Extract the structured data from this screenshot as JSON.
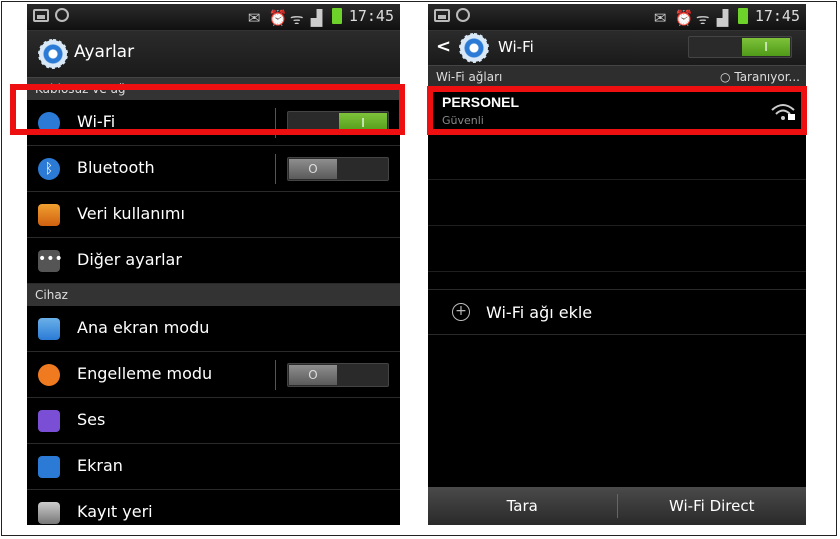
{
  "status": {
    "time": "17:45"
  },
  "left": {
    "title": "Ayarlar",
    "sections": {
      "wireless": "Kablosuz ve ağ",
      "device": "Cihaz"
    },
    "items": [
      {
        "label": "Wi-Fi",
        "icon": "wifi-icon",
        "toggle": "on",
        "toggle_text": "I"
      },
      {
        "label": "Bluetooth",
        "icon": "bluetooth-icon",
        "toggle": "off",
        "toggle_text": "O"
      },
      {
        "label": "Veri kullanımı",
        "icon": "data-usage-icon"
      },
      {
        "label": "Diğer ayarlar",
        "icon": "more-icon"
      },
      {
        "label": "Ana ekran modu",
        "icon": "home-icon"
      },
      {
        "label": "Engelleme modu",
        "icon": "block-icon",
        "toggle": "off",
        "toggle_text": "O"
      },
      {
        "label": "Ses",
        "icon": "sound-icon"
      },
      {
        "label": "Ekran",
        "icon": "display-icon"
      },
      {
        "label": "Kayıt yeri",
        "icon": "storage-icon"
      }
    ]
  },
  "right": {
    "back": "<",
    "title": "Wi-Fi",
    "toggle_text": "I",
    "networks_header": "Wi-Fi ağları",
    "scanning": "Taranıyor...",
    "network": {
      "name": "PERSONEL",
      "security": "Güvenli"
    },
    "add_network": "Wi-Fi ağı ekle",
    "bottom": {
      "scan": "Tara",
      "direct": "Wi-Fi Direct"
    }
  },
  "colors": {
    "highlight": "#ee1010",
    "toggle_on": "#6dbb2a",
    "accent": "#2b7bd6"
  }
}
